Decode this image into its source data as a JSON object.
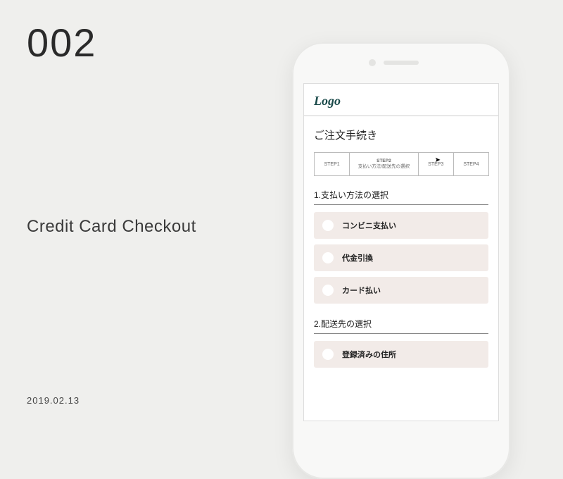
{
  "challenge": {
    "number": "002",
    "title": "Credit Card Checkout",
    "date": "2019.02.13"
  },
  "screen": {
    "logo": "Logo",
    "order_title": "ご注文手続き",
    "steps": {
      "s1": "STEP1",
      "s2_top": "STEP2",
      "s2_sub": "支払い方法/配送先の選択",
      "s3": "STEP3",
      "s4": "STEP4"
    },
    "section1_title": "1.支払い方法の選択",
    "payment_options": {
      "opt1": "コンビニ支払い",
      "opt2": "代金引換",
      "opt3": "カード払い"
    },
    "section2_title": "2.配送先の選択",
    "shipping_options": {
      "opt1": "登録済みの住所"
    }
  }
}
